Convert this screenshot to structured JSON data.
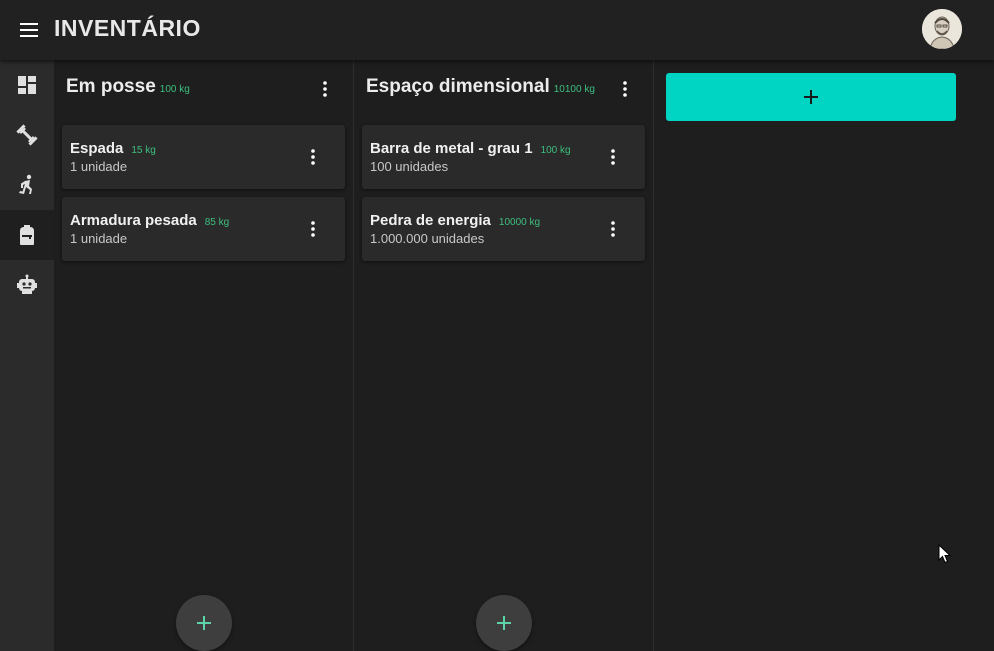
{
  "app": {
    "title": "INVENTÁRIO"
  },
  "colors": {
    "accent": "#00d4c2",
    "weight_green": "#3dbf7e",
    "background": "#1e1e1e"
  },
  "rail": {
    "items": [
      {
        "icon": "dashboard-icon",
        "active": false
      },
      {
        "icon": "dumbbell-icon",
        "active": false
      },
      {
        "icon": "running-icon",
        "active": false
      },
      {
        "icon": "backpack-icon",
        "active": true
      },
      {
        "icon": "robot-icon",
        "active": false
      }
    ]
  },
  "columns": [
    {
      "title": "Em posse",
      "weight": "100 kg",
      "items": [
        {
          "name": "Espada",
          "weight": "15 kg",
          "quantity": "1 unidade"
        },
        {
          "name": "Armadura pesada",
          "weight": "85 kg",
          "quantity": "1 unidade"
        }
      ],
      "add_icon": "plus-icon"
    },
    {
      "title": "Espaço dimensional",
      "weight": "10100 kg",
      "items": [
        {
          "name": "Barra de metal - grau 1",
          "weight": "100 kg",
          "quantity": "100 unidades"
        },
        {
          "name": "Pedra de energia",
          "weight": "10000 kg",
          "quantity": "1.000.000 unidades"
        }
      ],
      "add_icon": "plus-icon"
    }
  ],
  "add_column_icon": "plus-icon"
}
